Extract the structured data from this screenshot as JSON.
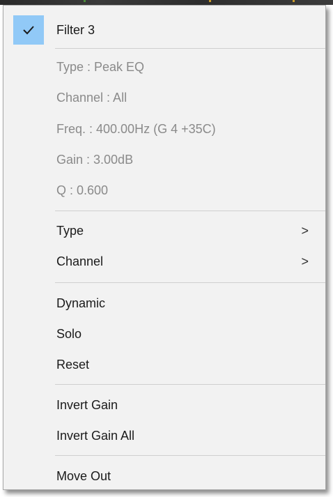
{
  "menu": {
    "header": {
      "label": "Filter 3",
      "checked": true,
      "check_icon": "checkmark-icon"
    },
    "info": {
      "type": "Type : Peak EQ",
      "channel": "Channel : All",
      "freq": "Freq. : 400.00Hz (G 4 +35C)",
      "gain": "Gain : 3.00dB",
      "q": "Q : 0.600"
    },
    "submenus": [
      {
        "label": "Type",
        "arrow": ">"
      },
      {
        "label": "Channel",
        "arrow": ">"
      }
    ],
    "actions": [
      {
        "label": "Dynamic"
      },
      {
        "label": "Solo"
      },
      {
        "label": "Reset"
      }
    ],
    "invert": [
      {
        "label": "Invert Gain"
      },
      {
        "label": "Invert Gain All"
      }
    ],
    "move": {
      "label": "Move Out"
    }
  },
  "colors": {
    "check_highlight": "#91c9f7",
    "menu_background": "#f2f2f2",
    "disabled_text": "#8a8a8a"
  }
}
